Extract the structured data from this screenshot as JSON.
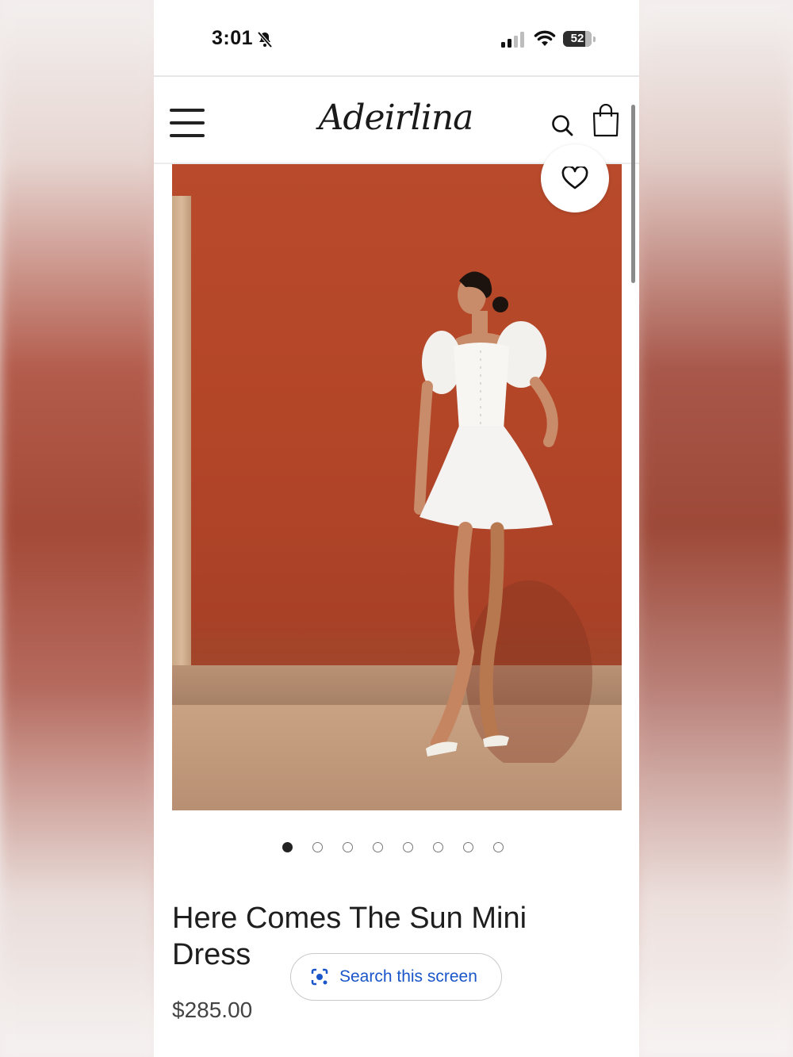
{
  "status_bar": {
    "time": "3:01",
    "battery": "52"
  },
  "header": {
    "brand": "Adeirlina"
  },
  "icons": [
    "bell-off-icon",
    "signal-icon",
    "wifi-icon",
    "menu-icon",
    "search-icon",
    "bag-icon",
    "heart-icon",
    "lens-icon"
  ],
  "gallery": {
    "image_count": 8,
    "active_index": 0
  },
  "product": {
    "title": "Here Comes The Sun Mini Dress",
    "price": "$285.00"
  },
  "overlay": {
    "lens_label": "Search this screen"
  },
  "colors": {
    "accent_blue": "#1a56c9",
    "wall": "#b44628"
  }
}
